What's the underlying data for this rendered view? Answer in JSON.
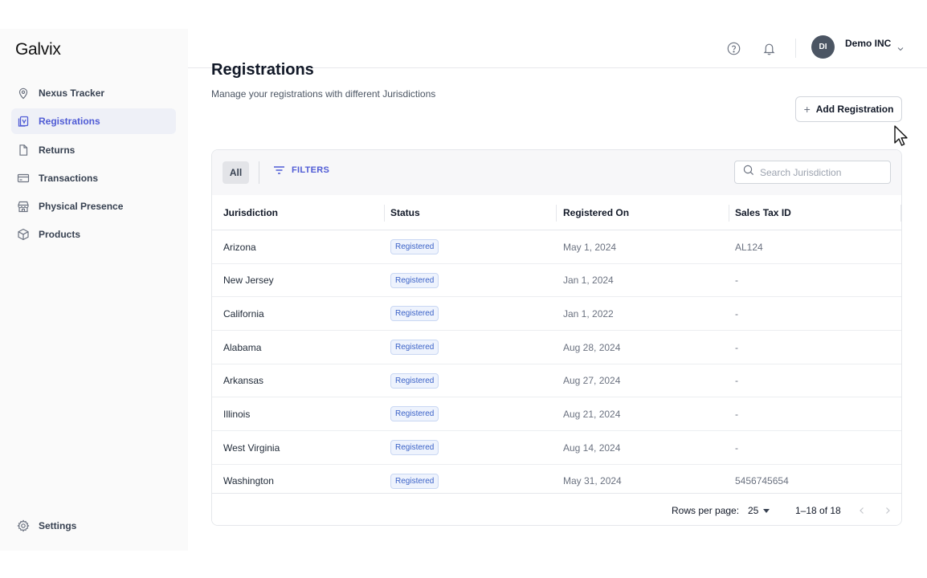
{
  "brand": {
    "name": "Galvix"
  },
  "sidebar": {
    "items": [
      {
        "label": "Nexus Tracker",
        "icon": "map-pin-icon",
        "active": false
      },
      {
        "label": "Registrations",
        "icon": "registration-icon",
        "active": true
      },
      {
        "label": "Returns",
        "icon": "file-icon",
        "active": false
      },
      {
        "label": "Transactions",
        "icon": "credit-card-icon",
        "active": false
      },
      {
        "label": "Physical Presence",
        "icon": "store-icon",
        "active": false
      },
      {
        "label": "Products",
        "icon": "cube-icon",
        "active": false
      }
    ],
    "settings_label": "Settings"
  },
  "header": {
    "avatar_initials": "DI",
    "company_name": "Demo INC"
  },
  "page": {
    "title": "Registrations",
    "subtitle": "Manage your registrations with different Jurisdictions",
    "add_button_label": "Add Registration"
  },
  "toolbar": {
    "all_label": "All",
    "filters_label": "FILTERS",
    "search_placeholder": "Search Jurisdiction"
  },
  "table": {
    "columns": [
      "Jurisdiction",
      "Status",
      "Registered On",
      "Sales Tax ID"
    ],
    "rows": [
      {
        "jurisdiction": "Arizona",
        "status": "Registered",
        "registered_on": "May 1, 2024",
        "sales_tax_id": "AL124"
      },
      {
        "jurisdiction": "New Jersey",
        "status": "Registered",
        "registered_on": "Jan 1, 2024",
        "sales_tax_id": "-"
      },
      {
        "jurisdiction": "California",
        "status": "Registered",
        "registered_on": "Jan 1, 2022",
        "sales_tax_id": "-"
      },
      {
        "jurisdiction": "Alabama",
        "status": "Registered",
        "registered_on": "Aug 28, 2024",
        "sales_tax_id": "-"
      },
      {
        "jurisdiction": "Arkansas",
        "status": "Registered",
        "registered_on": "Aug 27, 2024",
        "sales_tax_id": "-"
      },
      {
        "jurisdiction": "Illinois",
        "status": "Registered",
        "registered_on": "Aug 21, 2024",
        "sales_tax_id": "-"
      },
      {
        "jurisdiction": "West Virginia",
        "status": "Registered",
        "registered_on": "Aug 14, 2024",
        "sales_tax_id": "-"
      },
      {
        "jurisdiction": "Washington",
        "status": "Registered",
        "registered_on": "May 31, 2024",
        "sales_tax_id": "5456745654"
      }
    ]
  },
  "pagination": {
    "rows_per_page_label": "Rows per page:",
    "rows_per_page_value": "25",
    "range_label": "1–18 of 18"
  },
  "colors": {
    "accent": "#4f5bd5",
    "badge_text": "#3b62c7",
    "badge_bg": "#eef3fd"
  }
}
